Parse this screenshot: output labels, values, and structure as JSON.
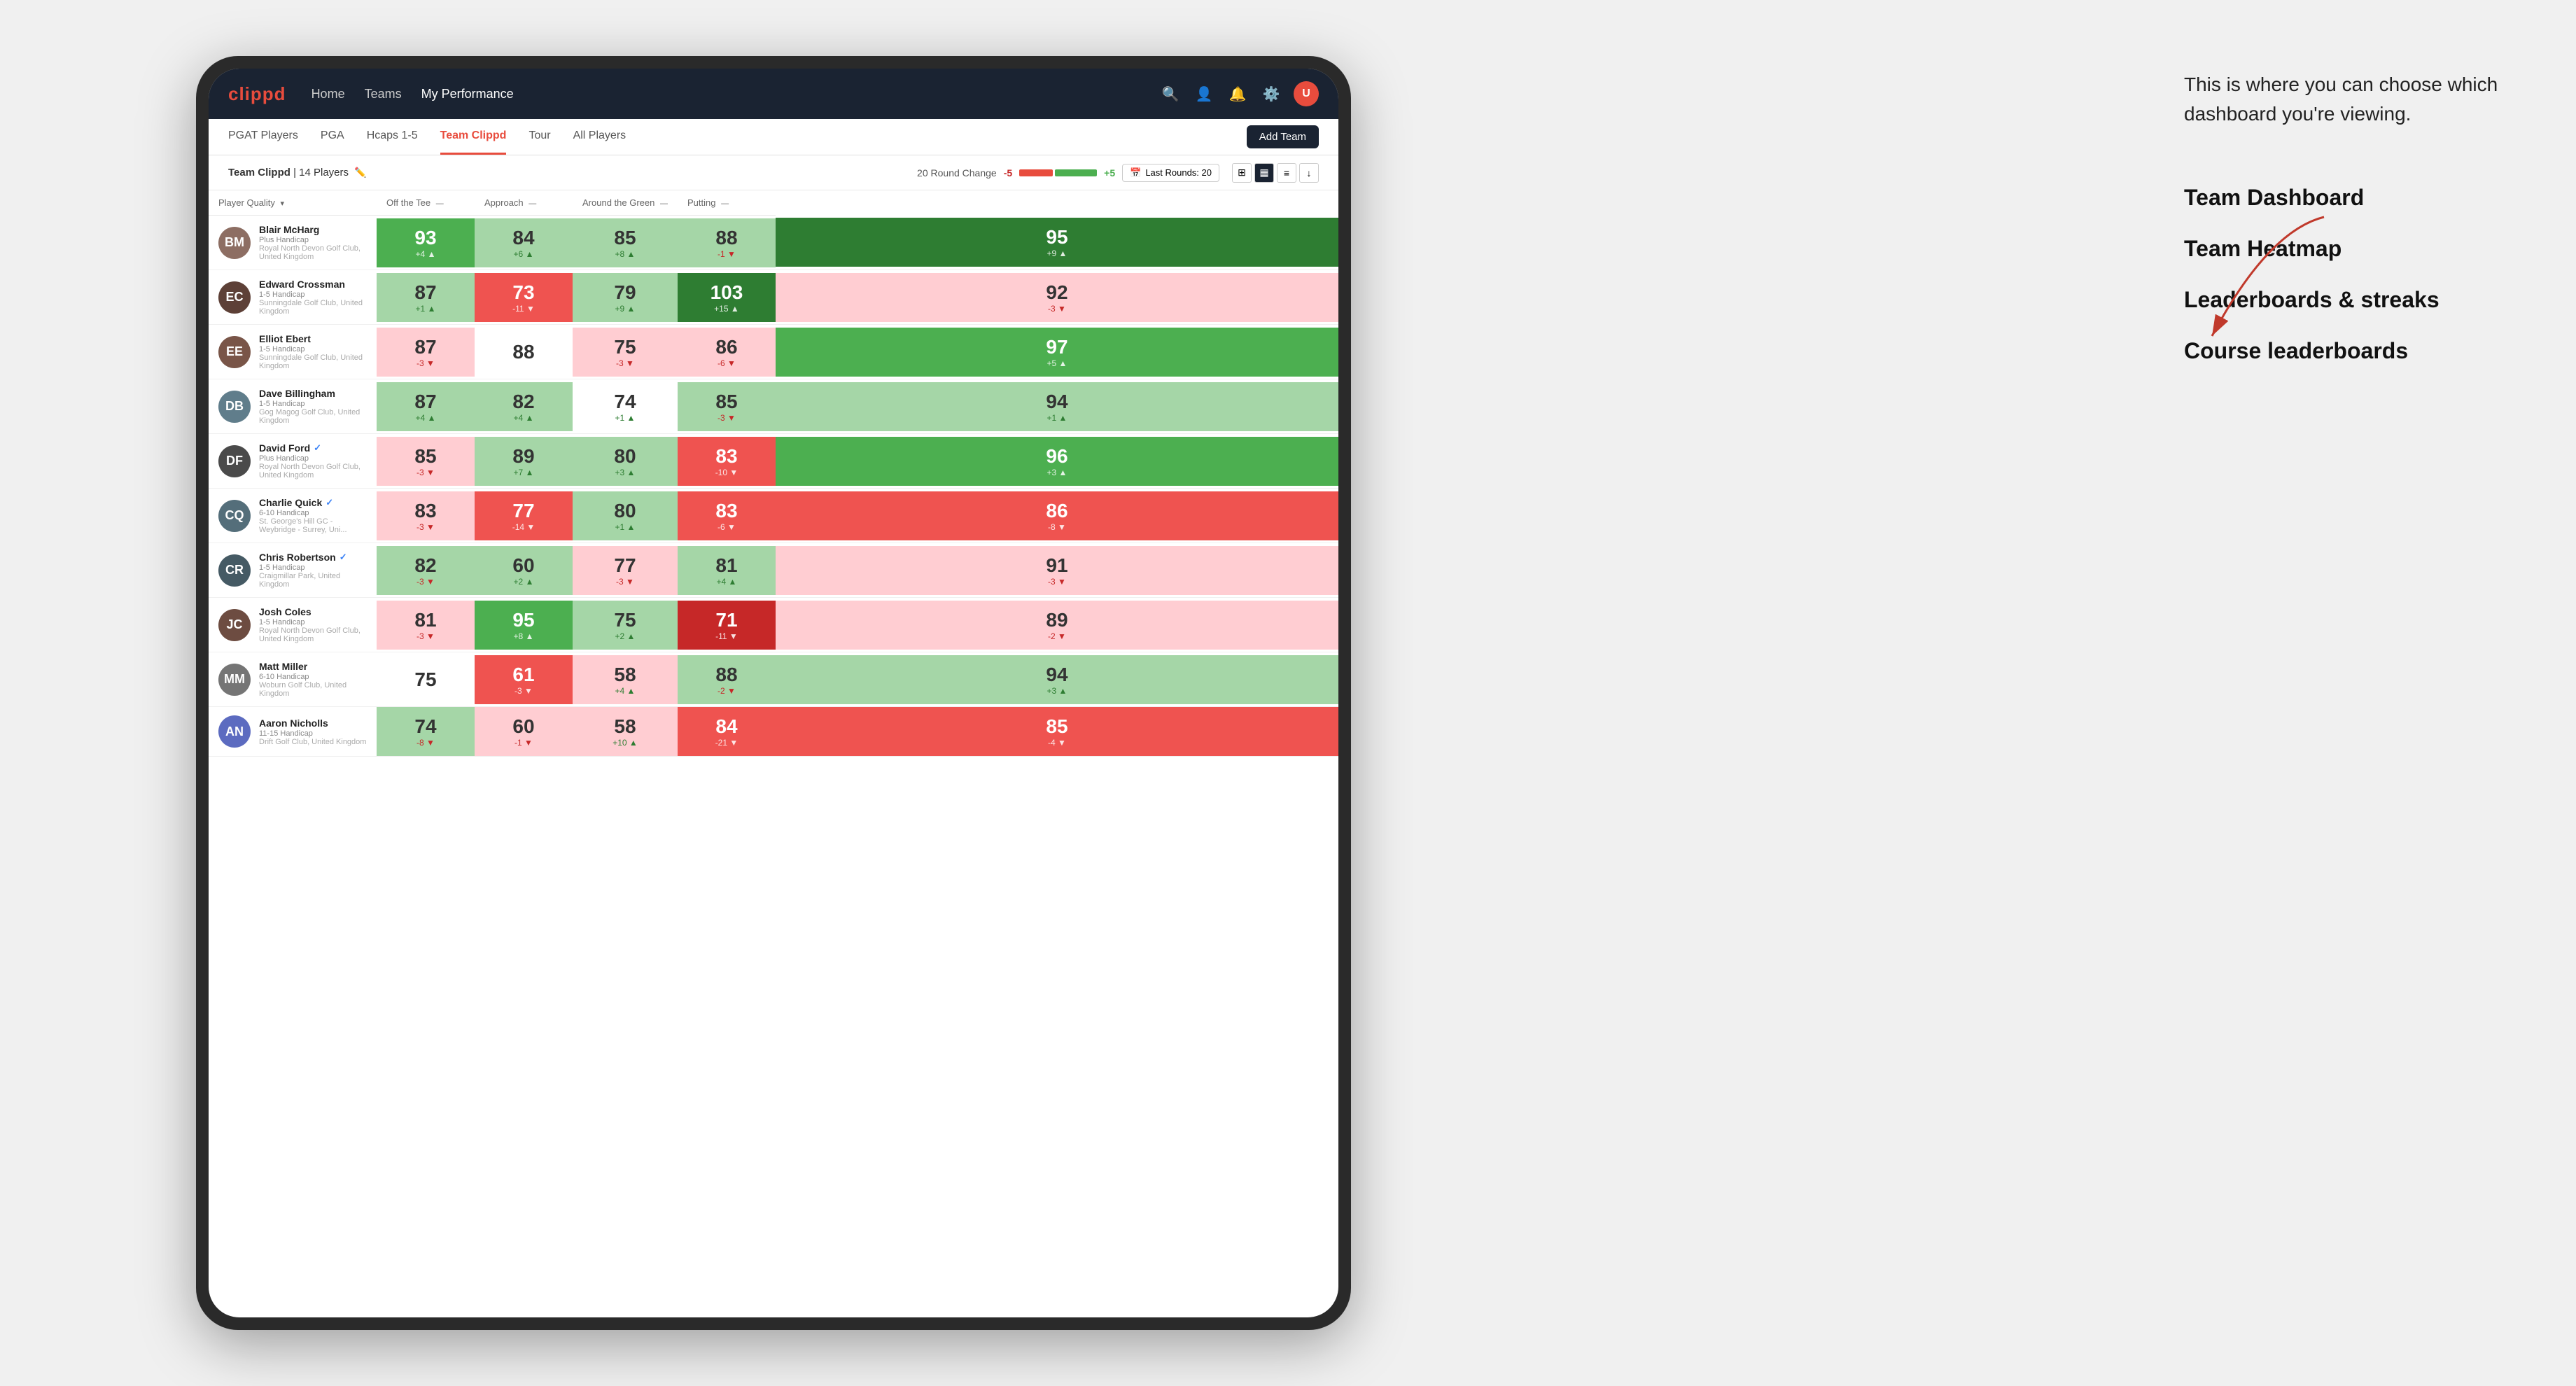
{
  "annotation": {
    "tooltip": "This is where you can choose which dashboard you're viewing.",
    "options": [
      "Team Dashboard",
      "Team Heatmap",
      "Leaderboards & streaks",
      "Course leaderboards"
    ]
  },
  "navbar": {
    "logo": "clippd",
    "links": [
      "Home",
      "Teams",
      "My Performance"
    ],
    "active_link": "My Performance"
  },
  "subnav": {
    "links": [
      "PGAT Players",
      "PGA",
      "Hcaps 1-5",
      "Team Clippd",
      "Tour",
      "All Players"
    ],
    "active_link": "Team Clippd",
    "add_team_label": "Add Team"
  },
  "team_header": {
    "title": "Team Clippd",
    "player_count": "14 Players",
    "round_change_label": "20 Round Change",
    "neg_label": "-5",
    "pos_label": "+5",
    "last_rounds_label": "Last Rounds:",
    "last_rounds_value": "20"
  },
  "table": {
    "headers": [
      {
        "label": "Player Quality",
        "sortable": true
      },
      {
        "label": "Off the Tee",
        "sortable": true
      },
      {
        "label": "Approach",
        "sortable": true
      },
      {
        "label": "Around the Green",
        "sortable": true
      },
      {
        "label": "Putting",
        "sortable": true
      }
    ],
    "rows": [
      {
        "name": "Blair McHarg",
        "handicap": "Plus Handicap",
        "club": "Royal North Devon Golf Club, United Kingdom",
        "avatar_color": "#8d6e63",
        "scores": [
          {
            "value": 93,
            "delta": "+4",
            "dir": "up",
            "bg": "bg-green-mid"
          },
          {
            "value": 84,
            "delta": "+6",
            "dir": "up",
            "bg": "bg-green-light"
          },
          {
            "value": 85,
            "delta": "+8",
            "dir": "up",
            "bg": "bg-green-light"
          },
          {
            "value": 88,
            "delta": "-1",
            "dir": "down",
            "bg": "bg-green-light"
          },
          {
            "value": 95,
            "delta": "+9",
            "dir": "up",
            "bg": "bg-green-strong"
          }
        ]
      },
      {
        "name": "Edward Crossman",
        "handicap": "1-5 Handicap",
        "club": "Sunningdale Golf Club, United Kingdom",
        "avatar_color": "#5d4037",
        "scores": [
          {
            "value": 87,
            "delta": "+1",
            "dir": "up",
            "bg": "bg-green-light"
          },
          {
            "value": 73,
            "delta": "-11",
            "dir": "down",
            "bg": "bg-red-mid"
          },
          {
            "value": 79,
            "delta": "+9",
            "dir": "up",
            "bg": "bg-green-light"
          },
          {
            "value": 103,
            "delta": "+15",
            "dir": "up",
            "bg": "bg-green-strong"
          },
          {
            "value": 92,
            "delta": "-3",
            "dir": "down",
            "bg": "bg-red-light"
          }
        ]
      },
      {
        "name": "Elliot Ebert",
        "handicap": "1-5 Handicap",
        "club": "Sunningdale Golf Club, United Kingdom",
        "avatar_color": "#795548",
        "scores": [
          {
            "value": 87,
            "delta": "-3",
            "dir": "down",
            "bg": "bg-red-light"
          },
          {
            "value": 88,
            "delta": "",
            "dir": "none",
            "bg": "bg-white"
          },
          {
            "value": 75,
            "delta": "-3",
            "dir": "down",
            "bg": "bg-red-light"
          },
          {
            "value": 86,
            "delta": "-6",
            "dir": "down",
            "bg": "bg-red-light"
          },
          {
            "value": 97,
            "delta": "+5",
            "dir": "up",
            "bg": "bg-green-mid"
          }
        ]
      },
      {
        "name": "Dave Billingham",
        "handicap": "1-5 Handicap",
        "club": "Gog Magog Golf Club, United Kingdom",
        "avatar_color": "#607d8b",
        "scores": [
          {
            "value": 87,
            "delta": "+4",
            "dir": "up",
            "bg": "bg-green-light"
          },
          {
            "value": 82,
            "delta": "+4",
            "dir": "up",
            "bg": "bg-green-light"
          },
          {
            "value": 74,
            "delta": "+1",
            "dir": "up",
            "bg": "bg-white"
          },
          {
            "value": 85,
            "delta": "-3",
            "dir": "down",
            "bg": "bg-green-light"
          },
          {
            "value": 94,
            "delta": "+1",
            "dir": "up",
            "bg": "bg-green-light"
          }
        ]
      },
      {
        "name": "David Ford",
        "handicap": "Plus Handicap",
        "club": "Royal North Devon Golf Club, United Kingdom",
        "avatar_color": "#4a4a4a",
        "verified": true,
        "scores": [
          {
            "value": 85,
            "delta": "-3",
            "dir": "down",
            "bg": "bg-red-light"
          },
          {
            "value": 89,
            "delta": "+7",
            "dir": "up",
            "bg": "bg-green-light"
          },
          {
            "value": 80,
            "delta": "+3",
            "dir": "up",
            "bg": "bg-green-light"
          },
          {
            "value": 83,
            "delta": "-10",
            "dir": "down",
            "bg": "bg-red-mid"
          },
          {
            "value": 96,
            "delta": "+3",
            "dir": "up",
            "bg": "bg-green-mid"
          }
        ]
      },
      {
        "name": "Charlie Quick",
        "handicap": "6-10 Handicap",
        "club": "St. George's Hill GC - Weybridge - Surrey, Uni...",
        "avatar_color": "#546e7a",
        "verified": true,
        "scores": [
          {
            "value": 83,
            "delta": "-3",
            "dir": "down",
            "bg": "bg-red-light"
          },
          {
            "value": 77,
            "delta": "-14",
            "dir": "down",
            "bg": "bg-red-mid"
          },
          {
            "value": 80,
            "delta": "+1",
            "dir": "up",
            "bg": "bg-green-light"
          },
          {
            "value": 83,
            "delta": "-6",
            "dir": "down",
            "bg": "bg-red-mid"
          },
          {
            "value": 86,
            "delta": "-8",
            "dir": "down",
            "bg": "bg-red-mid"
          }
        ]
      },
      {
        "name": "Chris Robertson",
        "handicap": "1-5 Handicap",
        "club": "Craigmillar Park, United Kingdom",
        "avatar_color": "#455a64",
        "verified": true,
        "scores": [
          {
            "value": 82,
            "delta": "-3",
            "dir": "down",
            "bg": "bg-green-light"
          },
          {
            "value": 60,
            "delta": "+2",
            "dir": "up",
            "bg": "bg-green-light"
          },
          {
            "value": 77,
            "delta": "-3",
            "dir": "down",
            "bg": "bg-red-light"
          },
          {
            "value": 81,
            "delta": "+4",
            "dir": "up",
            "bg": "bg-green-light"
          },
          {
            "value": 91,
            "delta": "-3",
            "dir": "down",
            "bg": "bg-red-light"
          }
        ]
      },
      {
        "name": "Josh Coles",
        "handicap": "1-5 Handicap",
        "club": "Royal North Devon Golf Club, United Kingdom",
        "avatar_color": "#6d4c41",
        "scores": [
          {
            "value": 81,
            "delta": "-3",
            "dir": "down",
            "bg": "bg-red-light"
          },
          {
            "value": 95,
            "delta": "+8",
            "dir": "up",
            "bg": "bg-green-mid"
          },
          {
            "value": 75,
            "delta": "+2",
            "dir": "up",
            "bg": "bg-green-light"
          },
          {
            "value": 71,
            "delta": "-11",
            "dir": "down",
            "bg": "bg-red-strong"
          },
          {
            "value": 89,
            "delta": "-2",
            "dir": "down",
            "bg": "bg-red-light"
          }
        ]
      },
      {
        "name": "Matt Miller",
        "handicap": "6-10 Handicap",
        "club": "Woburn Golf Club, United Kingdom",
        "avatar_color": "#757575",
        "scores": [
          {
            "value": 75,
            "delta": "",
            "dir": "none",
            "bg": "bg-white"
          },
          {
            "value": 61,
            "delta": "-3",
            "dir": "down",
            "bg": "bg-red-mid"
          },
          {
            "value": 58,
            "delta": "+4",
            "dir": "up",
            "bg": "bg-red-light"
          },
          {
            "value": 88,
            "delta": "-2",
            "dir": "down",
            "bg": "bg-green-light"
          },
          {
            "value": 94,
            "delta": "+3",
            "dir": "up",
            "bg": "bg-green-light"
          }
        ]
      },
      {
        "name": "Aaron Nicholls",
        "handicap": "11-15 Handicap",
        "club": "Drift Golf Club, United Kingdom",
        "avatar_color": "#5c6bc0",
        "scores": [
          {
            "value": 74,
            "delta": "-8",
            "dir": "down",
            "bg": "bg-green-light"
          },
          {
            "value": 60,
            "delta": "-1",
            "dir": "down",
            "bg": "bg-red-light"
          },
          {
            "value": 58,
            "delta": "+10",
            "dir": "up",
            "bg": "bg-red-light"
          },
          {
            "value": 84,
            "delta": "-21",
            "dir": "down",
            "bg": "bg-red-mid"
          },
          {
            "value": 85,
            "delta": "-4",
            "dir": "down",
            "bg": "bg-red-mid"
          }
        ]
      }
    ]
  }
}
